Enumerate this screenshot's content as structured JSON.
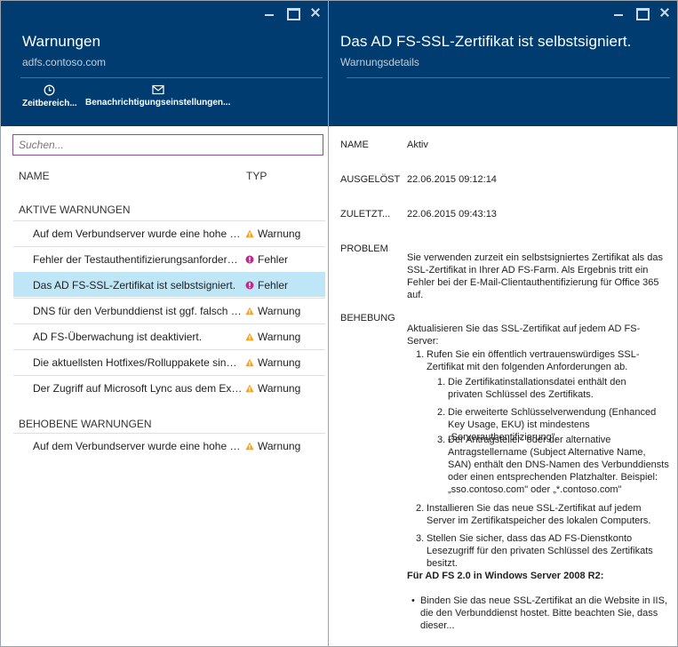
{
  "left_blade": {
    "title": "Warnungen",
    "subtitle": "adfs.contoso.com",
    "commands": [
      {
        "label": "Zeitbereich...",
        "icon": "clock-icon"
      },
      {
        "label": "Benachrichtigungseinstellungen...",
        "icon": "mail-icon"
      }
    ],
    "search_placeholder": "Suchen...",
    "columns": {
      "name": "NAME",
      "type": "TYP"
    },
    "active_section": "AKTIVE WARNUNGEN",
    "active_alerts": [
      {
        "name": "Auf dem Verbundserver wurde eine hohe C...",
        "type": "Warnung",
        "severity": "warning"
      },
      {
        "name": "Fehler der Testauthentifizierungsanforderun...",
        "type": "Fehler",
        "severity": "error"
      },
      {
        "name": "Das AD FS-SSL-Zertifikat ist selbstsigniert.",
        "type": "Fehler",
        "severity": "error",
        "selected": true
      },
      {
        "name": "DNS für den Verbunddienst ist ggf. falsch k...",
        "type": "Warnung",
        "severity": "warning"
      },
      {
        "name": "AD FS-Überwachung ist deaktiviert.",
        "type": "Warnung",
        "severity": "warning"
      },
      {
        "name": "Die aktuellsten Hotfixes/Rolluppakete sind ...",
        "type": "Warnung",
        "severity": "warning"
      },
      {
        "name": "Der Zugriff auf Microsoft Lync aus dem Extr...",
        "type": "Warnung",
        "severity": "warning"
      }
    ],
    "resolved_section": "BEHOBENE WARNUNGEN",
    "resolved_alerts": [
      {
        "name": "Auf dem Verbundserver wurde eine hohe C...",
        "type": "Warnung",
        "severity": "warning"
      }
    ]
  },
  "right_blade": {
    "title": "Das AD FS-SSL-Zertifikat ist selbstsigniert.",
    "subtitle": "Warnungsdetails",
    "fields": {
      "name_label": "NAME",
      "name_value": "Aktiv",
      "triggered_label": "AUSGELÖST",
      "triggered_value": "22.06.2015 09:12:14",
      "last_label": "ZULETZT...",
      "last_value": "22.06.2015 09:43:13",
      "problem_label": "PROBLEM",
      "problem_text": "Sie verwenden zurzeit ein selbstsigniertes Zertifikat als das SSL-Zertifikat in Ihrer AD FS-Farm. Als Ergebnis tritt ein Fehler bei der E-Mail-Clientauthentifizierung für Office 365 auf.",
      "resolution_label": "BEHEBUNG"
    },
    "resolution": {
      "intro": "Aktualisieren Sie das SSL-Zertifikat auf jedem AD FS-Server:",
      "step1": "Rufen Sie ein öffentlich vertrauenswürdiges SSL-Zertifikat mit den folgenden Anforderungen ab.",
      "step1_sub1": "Die Zertifikatinstallationsdatei enthält den privaten Schlüssel des Zertifikats.",
      "step1_sub2": "Die erweiterte Schlüsselverwendung (Enhanced Key Usage, EKU) ist mindestens „Serverauthentifizierung\".",
      "step1_sub3": "Der Antragsteller- oder der alternative Antragstellername (Subject Alternative Name, SAN) enthält den DNS-Namen des Verbunddiensts oder einen entsprechenden Platzhalter. Beispiel: „sso.contoso.com\" oder „*.contoso.com\"",
      "step2": "Installieren Sie das neue SSL-Zertifikat auf jedem Server im Zertifikatspeicher des lokalen Computers.",
      "step3": "Stellen Sie sicher, dass das AD FS-Dienstkonto Lesezugriff für den privaten Schlüssel des Zertifikats besitzt.",
      "adfs20_heading": "Für AD FS 2.0 in Windows Server 2008 R2:",
      "bullet1": "Binden Sie das neue SSL-Zertifikat an die Website in IIS, die den Verbunddienst hostet. Bitte beachten Sie, dass dieser..."
    }
  },
  "colors": {
    "header_bg": "#003c6f",
    "selected_row": "#bfe6f7",
    "warning": "#f2a51c",
    "error": "#c5288c"
  }
}
